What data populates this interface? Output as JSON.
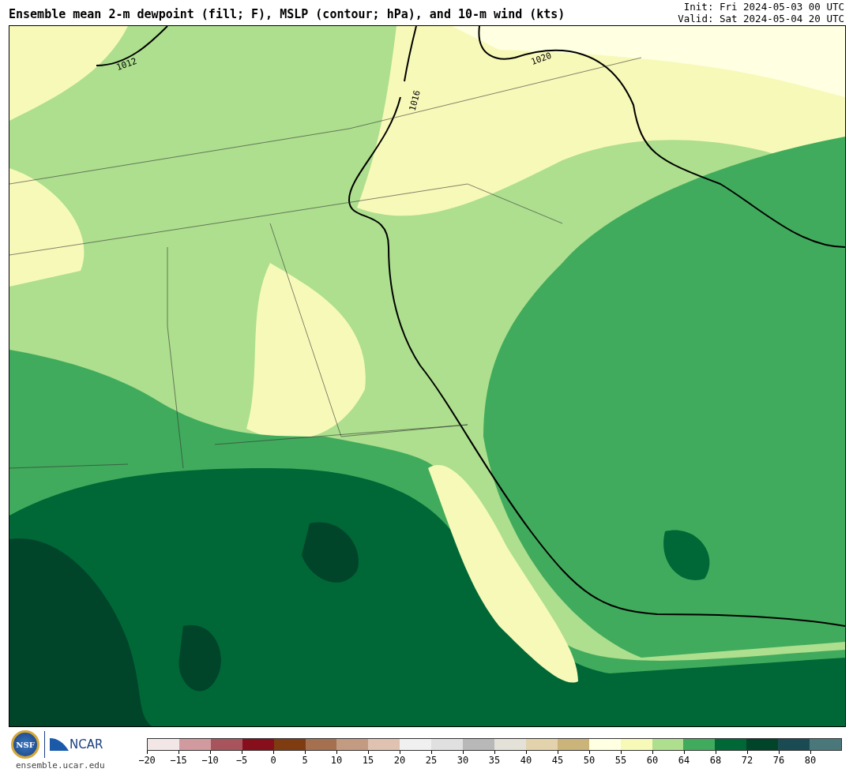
{
  "title": "Ensemble mean 2-m dewpoint (fill; F), MSLP (contour; hPa), and 10-m wind (kts)",
  "init": "Init: Fri 2024-05-03 00 UTC",
  "valid": "Valid: Sat 2024-05-04 20 UTC",
  "map": {
    "contour_labels": [
      "1012",
      "1016",
      "1020"
    ]
  },
  "logos": {
    "nsf": "NSF",
    "ncar": "NCAR",
    "site": "ensemble.ucar.edu"
  },
  "colorbar": [
    {
      "color": "#f3e6e6",
      "label": "−20"
    },
    {
      "color": "#d19a9e",
      "label": "−15"
    },
    {
      "color": "#a8545c",
      "label": "−10"
    },
    {
      "color": "#870f1c",
      "label": "−5"
    },
    {
      "color": "#7f3c10",
      "label": "0"
    },
    {
      "color": "#a5704f",
      "label": "5"
    },
    {
      "color": "#c39b80",
      "label": "10"
    },
    {
      "color": "#dfc3b0",
      "label": "15"
    },
    {
      "color": "#f0f0f0",
      "label": "20"
    },
    {
      "color": "#e0e0e0",
      "label": "25"
    },
    {
      "color": "#b8b8b8",
      "label": "30"
    },
    {
      "color": "#e4e2d8",
      "label": "35"
    },
    {
      "color": "#e3d3ad",
      "label": "40"
    },
    {
      "color": "#cbb47a",
      "label": "45"
    },
    {
      "color": "#ffffe2",
      "label": "50"
    },
    {
      "color": "#f7f9b8",
      "label": "55"
    },
    {
      "color": "#addf8e",
      "label": "60"
    },
    {
      "color": "#41ab5d",
      "label": "64"
    },
    {
      "color": "#006837",
      "label": "68"
    },
    {
      "color": "#00442a",
      "label": "72"
    },
    {
      "color": "#1a4b52",
      "label": "76"
    },
    {
      "color": "#4a787a",
      "label": "80"
    }
  ]
}
